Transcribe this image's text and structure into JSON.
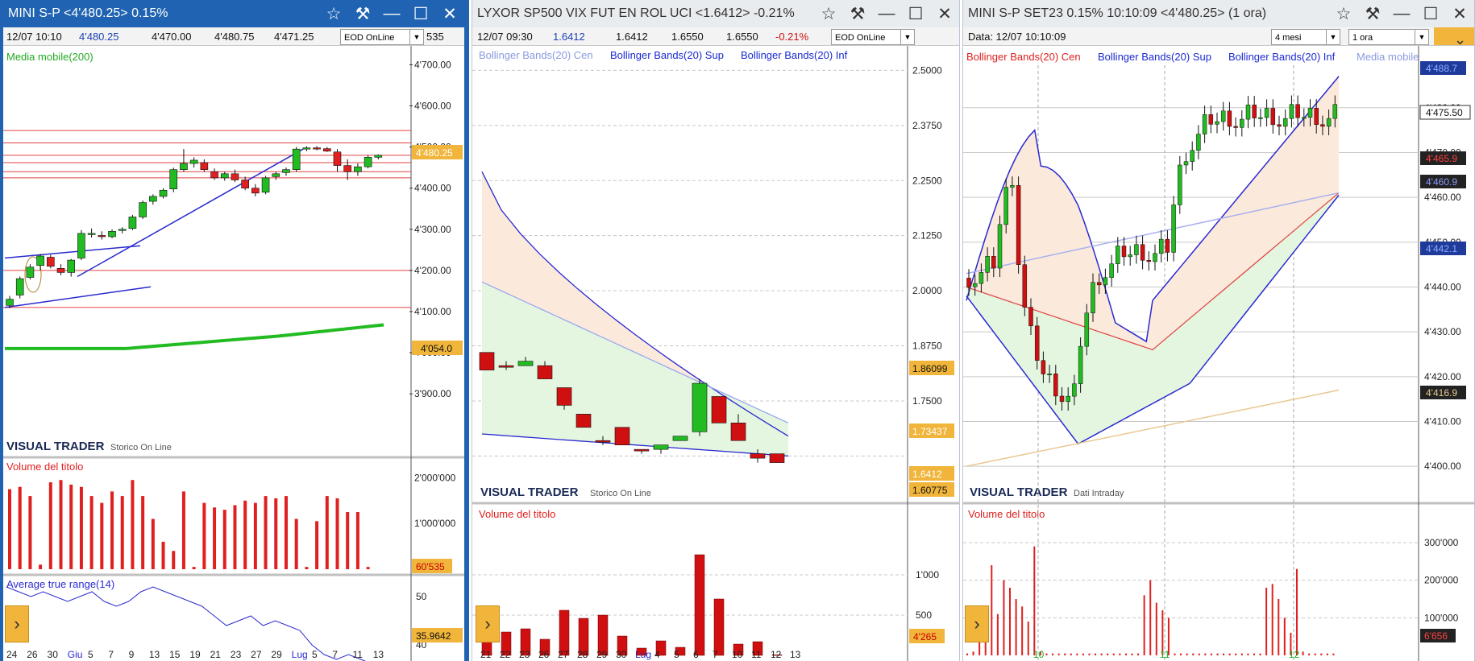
{
  "windows": [
    {
      "title": "MINI S-P <4'480.25> 0.15%",
      "info": {
        "date": "12/07 10:10",
        "last": "4'480.25",
        "open": "4'470.00",
        "high": "4'480.75",
        "low": "4'471.25",
        "close_trunc": "535",
        "mode": "EOD OnLine"
      },
      "main": {
        "indicator_label": "Media mobile(200)",
        "brand": "VISUAL TRADER",
        "brand_sub": "Storico On Line",
        "y_ticks": [
          "4'700.00",
          "4'600.00",
          "4'500.00",
          "4'400.00",
          "4'300.00",
          "4'200.00",
          "4'100.00",
          "4'000.00",
          "3'900.00"
        ],
        "price_tag": "4'480.25",
        "ma_tag": "4'054.0"
      },
      "volume": {
        "label": "Volume del titolo",
        "y_ticks": [
          "2'000'000",
          "1'000'000"
        ],
        "last": "60'535"
      },
      "atr": {
        "label": "Average true range(14)",
        "y_ticks": [
          "50",
          "40"
        ],
        "last": "35.9642"
      },
      "x_ticks": [
        "24",
        "26",
        "30",
        "Giu",
        "5",
        "7",
        "9",
        "13",
        "15",
        "19",
        "21",
        "23",
        "27",
        "29",
        "Lug",
        "5",
        "7",
        "11",
        "13"
      ]
    },
    {
      "title": "LYXOR SP500 VIX FUT EN ROL UCI <1.6412> -0.21%",
      "info": {
        "date": "12/07 09:30",
        "last": "1.6412",
        "open": "1.6412",
        "high": "1.6550",
        "low": "1.6550",
        "change": "-0.21%",
        "mode": "EOD OnLine"
      },
      "main": {
        "legend": [
          "Bollinger Bands(20) Cen",
          "Bollinger Bands(20) Sup",
          "Bollinger Bands(20) Inf"
        ],
        "brand": "VISUAL TRADER",
        "brand_sub": "Storico On Line",
        "y_ticks": [
          "2.5000",
          "2.3750",
          "2.2500",
          "2.1250",
          "2.0000",
          "1.8750",
          "1.7500"
        ],
        "tags": [
          "1.86099",
          "1.73437",
          "1.6412",
          "1.60775"
        ]
      },
      "volume": {
        "label": "Volume del titolo",
        "y_ticks": [
          "1'000",
          "500"
        ],
        "last": "4'265"
      },
      "x_ticks": [
        "21",
        "22",
        "23",
        "26",
        "27",
        "28",
        "29",
        "30",
        "Lug",
        "4",
        "5",
        "6",
        "7",
        "10",
        "11",
        "12",
        "13"
      ]
    },
    {
      "title": "MINI S-P SET23 0.15% 10:10:09 <4'480.25> (1 ora)",
      "info": {
        "data_label": "Data: 12/07 10:10:09",
        "period": "4 mesi",
        "interval": "1 ora"
      },
      "main": {
        "legend": [
          "Bollinger Bands(20) Cen",
          "Bollinger Bands(20) Sup",
          "Bollinger Bands(20) Inf",
          "Media mobile"
        ],
        "brand": "VISUAL TRADER",
        "brand_sub": "Dati Intraday",
        "y_ticks": [
          "4'480.00",
          "4'470.00",
          "4'460.00",
          "4'450.00",
          "4'440.00",
          "4'430.00",
          "4'420.00",
          "4'410.00",
          "4'400.00"
        ],
        "tags": [
          "4'488.7",
          "4'475.50",
          "4'465.9",
          "4'460.9",
          "4'442.1",
          "4'416.9"
        ]
      },
      "volume": {
        "label": "Volume del titolo",
        "y_ticks": [
          "300'000",
          "200'000",
          "100'000"
        ],
        "last": "6'656"
      },
      "x_ticks": [
        "10",
        "11",
        "12"
      ]
    }
  ],
  "chart_data": [
    {
      "type": "candlestick",
      "name": "MINI S-P daily",
      "ohlc": [
        [
          4115,
          4138,
          4108,
          4130
        ],
        [
          4140,
          4185,
          4132,
          4180
        ],
        [
          4183,
          4215,
          4178,
          4208
        ],
        [
          4212,
          4240,
          4200,
          4235
        ],
        [
          4232,
          4238,
          4205,
          4210
        ],
        [
          4205,
          4215,
          4188,
          4195
        ],
        [
          4195,
          4228,
          4185,
          4225
        ],
        [
          4230,
          4298,
          4225,
          4290
        ],
        [
          4288,
          4302,
          4280,
          4290
        ],
        [
          4285,
          4295,
          4275,
          4282
        ],
        [
          4282,
          4300,
          4278,
          4295
        ],
        [
          4298,
          4305,
          4290,
          4300
        ],
        [
          4302,
          4335,
          4298,
          4330
        ],
        [
          4330,
          4370,
          4325,
          4365
        ],
        [
          4368,
          4385,
          4360,
          4380
        ],
        [
          4380,
          4400,
          4375,
          4395
        ],
        [
          4398,
          4450,
          4390,
          4445
        ],
        [
          4445,
          4495,
          4440,
          4460
        ],
        [
          4460,
          4475,
          4450,
          4468
        ],
        [
          4462,
          4470,
          4440,
          4445
        ],
        [
          4440,
          4448,
          4420,
          4425
        ],
        [
          4425,
          4440,
          4418,
          4435
        ],
        [
          4435,
          4445,
          4415,
          4420
        ],
        [
          4420,
          4428,
          4395,
          4400
        ],
        [
          4400,
          4410,
          4380,
          4388
        ],
        [
          4390,
          4430,
          4385,
          4425
        ],
        [
          4428,
          4440,
          4420,
          4435
        ],
        [
          4438,
          4450,
          4430,
          4445
        ],
        [
          4445,
          4500,
          4440,
          4495
        ],
        [
          4495,
          4502,
          4490,
          4498
        ],
        [
          4498,
          4502,
          4492,
          4496
        ],
        [
          4496,
          4500,
          4488,
          4490
        ],
        [
          4488,
          4495,
          4440,
          4455
        ],
        [
          4455,
          4470,
          4420,
          4440
        ],
        [
          4440,
          4460,
          4430,
          4452
        ],
        [
          4452,
          4480,
          4448,
          4475
        ],
        [
          4475,
          4482,
          4470,
          4480
        ]
      ],
      "ylim": [
        3820,
        4740
      ]
    },
    {
      "type": "candlestick",
      "name": "LYXOR SP500 VIX",
      "ohlc": [
        [
          1.86,
          1.86,
          1.82,
          1.82
        ],
        [
          1.83,
          1.84,
          1.82,
          1.83
        ],
        [
          1.83,
          1.85,
          1.83,
          1.84
        ],
        [
          1.83,
          1.84,
          1.8,
          1.8
        ],
        [
          1.78,
          1.78,
          1.73,
          1.74
        ],
        [
          1.72,
          1.72,
          1.69,
          1.69
        ],
        [
          1.66,
          1.67,
          1.65,
          1.66
        ],
        [
          1.69,
          1.69,
          1.65,
          1.65
        ],
        [
          1.64,
          1.64,
          1.63,
          1.64
        ],
        [
          1.64,
          1.65,
          1.63,
          1.65
        ],
        [
          1.66,
          1.67,
          1.66,
          1.67
        ],
        [
          1.68,
          1.8,
          1.67,
          1.79
        ],
        [
          1.76,
          1.76,
          1.7,
          1.7
        ],
        [
          1.7,
          1.72,
          1.66,
          1.66
        ],
        [
          1.63,
          1.64,
          1.61,
          1.62
        ],
        [
          1.63,
          1.63,
          1.61,
          1.61
        ]
      ],
      "ylim": [
        1.58,
        2.53
      ]
    }
  ]
}
